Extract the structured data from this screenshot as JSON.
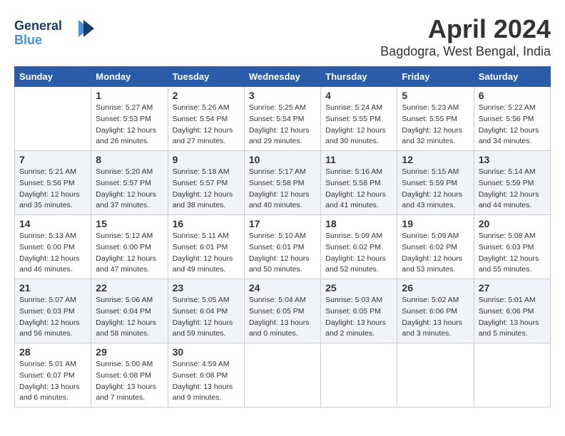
{
  "header": {
    "logo_line1": "General",
    "logo_line2": "Blue",
    "month_year": "April 2024",
    "location": "Bagdogra, West Bengal, India"
  },
  "days_of_week": [
    "Sunday",
    "Monday",
    "Tuesday",
    "Wednesday",
    "Thursday",
    "Friday",
    "Saturday"
  ],
  "weeks": [
    [
      {
        "day": "",
        "info": ""
      },
      {
        "day": "1",
        "info": "Sunrise: 5:27 AM\nSunset: 5:53 PM\nDaylight: 12 hours\nand 26 minutes."
      },
      {
        "day": "2",
        "info": "Sunrise: 5:26 AM\nSunset: 5:54 PM\nDaylight: 12 hours\nand 27 minutes."
      },
      {
        "day": "3",
        "info": "Sunrise: 5:25 AM\nSunset: 5:54 PM\nDaylight: 12 hours\nand 29 minutes."
      },
      {
        "day": "4",
        "info": "Sunrise: 5:24 AM\nSunset: 5:55 PM\nDaylight: 12 hours\nand 30 minutes."
      },
      {
        "day": "5",
        "info": "Sunrise: 5:23 AM\nSunset: 5:55 PM\nDaylight: 12 hours\nand 32 minutes."
      },
      {
        "day": "6",
        "info": "Sunrise: 5:22 AM\nSunset: 5:56 PM\nDaylight: 12 hours\nand 34 minutes."
      }
    ],
    [
      {
        "day": "7",
        "info": "Sunrise: 5:21 AM\nSunset: 5:56 PM\nDaylight: 12 hours\nand 35 minutes."
      },
      {
        "day": "8",
        "info": "Sunrise: 5:20 AM\nSunset: 5:57 PM\nDaylight: 12 hours\nand 37 minutes."
      },
      {
        "day": "9",
        "info": "Sunrise: 5:18 AM\nSunset: 5:57 PM\nDaylight: 12 hours\nand 38 minutes."
      },
      {
        "day": "10",
        "info": "Sunrise: 5:17 AM\nSunset: 5:58 PM\nDaylight: 12 hours\nand 40 minutes."
      },
      {
        "day": "11",
        "info": "Sunrise: 5:16 AM\nSunset: 5:58 PM\nDaylight: 12 hours\nand 41 minutes."
      },
      {
        "day": "12",
        "info": "Sunrise: 5:15 AM\nSunset: 5:59 PM\nDaylight: 12 hours\nand 43 minutes."
      },
      {
        "day": "13",
        "info": "Sunrise: 5:14 AM\nSunset: 5:59 PM\nDaylight: 12 hours\nand 44 minutes."
      }
    ],
    [
      {
        "day": "14",
        "info": "Sunrise: 5:13 AM\nSunset: 6:00 PM\nDaylight: 12 hours\nand 46 minutes."
      },
      {
        "day": "15",
        "info": "Sunrise: 5:12 AM\nSunset: 6:00 PM\nDaylight: 12 hours\nand 47 minutes."
      },
      {
        "day": "16",
        "info": "Sunrise: 5:11 AM\nSunset: 6:01 PM\nDaylight: 12 hours\nand 49 minutes."
      },
      {
        "day": "17",
        "info": "Sunrise: 5:10 AM\nSunset: 6:01 PM\nDaylight: 12 hours\nand 50 minutes."
      },
      {
        "day": "18",
        "info": "Sunrise: 5:09 AM\nSunset: 6:02 PM\nDaylight: 12 hours\nand 52 minutes."
      },
      {
        "day": "19",
        "info": "Sunrise: 5:09 AM\nSunset: 6:02 PM\nDaylight: 12 hours\nand 53 minutes."
      },
      {
        "day": "20",
        "info": "Sunrise: 5:08 AM\nSunset: 6:03 PM\nDaylight: 12 hours\nand 55 minutes."
      }
    ],
    [
      {
        "day": "21",
        "info": "Sunrise: 5:07 AM\nSunset: 6:03 PM\nDaylight: 12 hours\nand 56 minutes."
      },
      {
        "day": "22",
        "info": "Sunrise: 5:06 AM\nSunset: 6:04 PM\nDaylight: 12 hours\nand 58 minutes."
      },
      {
        "day": "23",
        "info": "Sunrise: 5:05 AM\nSunset: 6:04 PM\nDaylight: 12 hours\nand 59 minutes."
      },
      {
        "day": "24",
        "info": "Sunrise: 5:04 AM\nSunset: 6:05 PM\nDaylight: 13 hours\nand 0 minutes."
      },
      {
        "day": "25",
        "info": "Sunrise: 5:03 AM\nSunset: 6:05 PM\nDaylight: 13 hours\nand 2 minutes."
      },
      {
        "day": "26",
        "info": "Sunrise: 5:02 AM\nSunset: 6:06 PM\nDaylight: 13 hours\nand 3 minutes."
      },
      {
        "day": "27",
        "info": "Sunrise: 5:01 AM\nSunset: 6:06 PM\nDaylight: 13 hours\nand 5 minutes."
      }
    ],
    [
      {
        "day": "28",
        "info": "Sunrise: 5:01 AM\nSunset: 6:07 PM\nDaylight: 13 hours\nand 6 minutes."
      },
      {
        "day": "29",
        "info": "Sunrise: 5:00 AM\nSunset: 6:08 PM\nDaylight: 13 hours\nand 7 minutes."
      },
      {
        "day": "30",
        "info": "Sunrise: 4:59 AM\nSunset: 6:08 PM\nDaylight: 13 hours\nand 9 minutes."
      },
      {
        "day": "",
        "info": ""
      },
      {
        "day": "",
        "info": ""
      },
      {
        "day": "",
        "info": ""
      },
      {
        "day": "",
        "info": ""
      }
    ]
  ]
}
